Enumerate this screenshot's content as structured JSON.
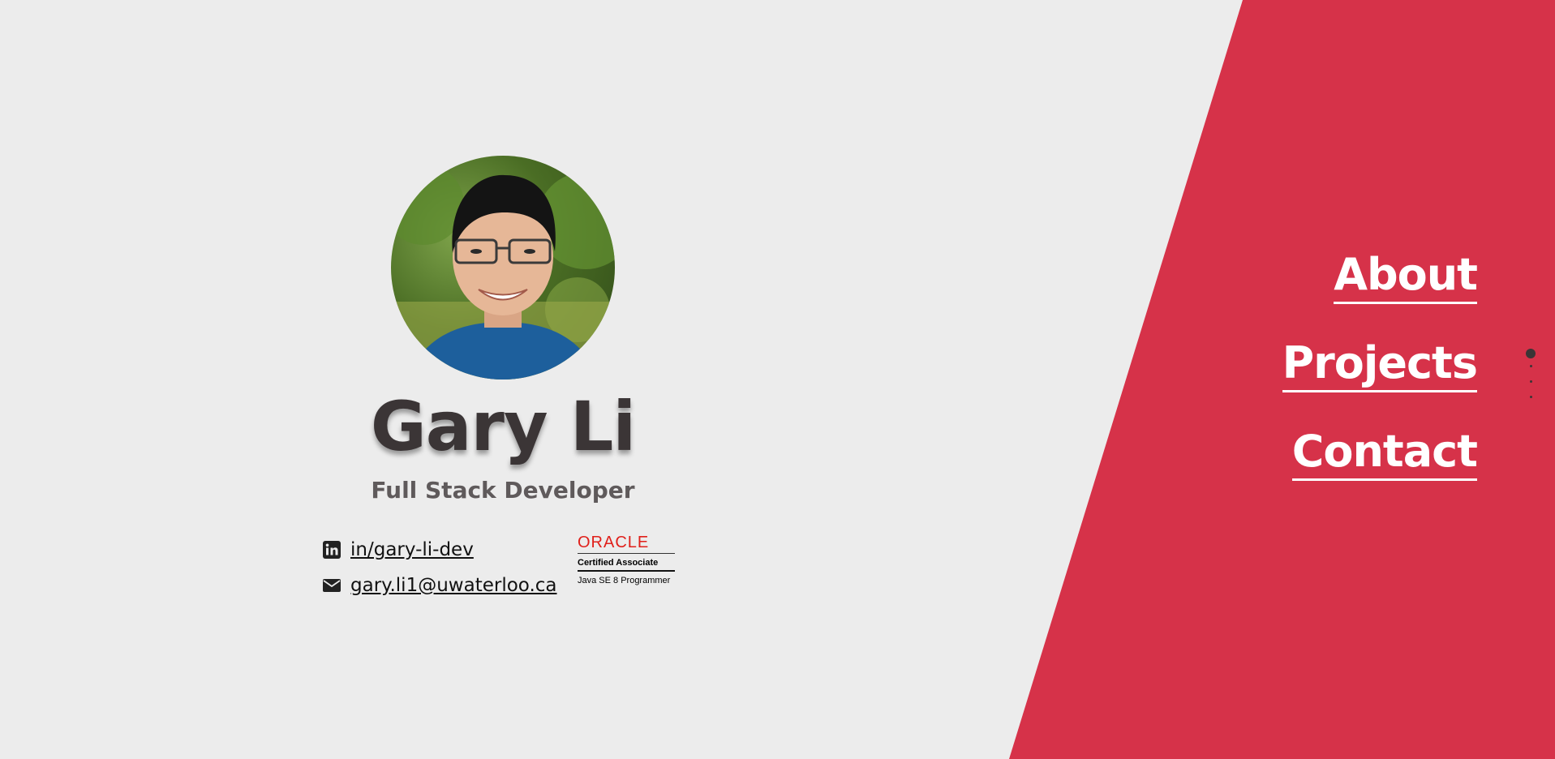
{
  "profile": {
    "name": "Gary Li",
    "subtitle": "Full Stack Developer",
    "avatar_icon": "profile-photo"
  },
  "contacts": [
    {
      "icon": "linkedin-icon",
      "label": "in/gary-li-dev"
    },
    {
      "icon": "envelope-icon",
      "label": "gary.li1@uwaterloo.ca"
    }
  ],
  "certification": {
    "brand": "ORACLE",
    "title": "Certified Associate",
    "subtitle": "Java SE 8 Programmer"
  },
  "nav": {
    "items": [
      {
        "label": "About"
      },
      {
        "label": "Projects"
      },
      {
        "label": "Contact"
      }
    ]
  },
  "page_indicator": {
    "count": 4,
    "active_index": 0
  },
  "colors": {
    "background": "#ececec",
    "accent": "#d63249",
    "text_dark": "#3b3536",
    "oracle_red": "#e0201b"
  }
}
